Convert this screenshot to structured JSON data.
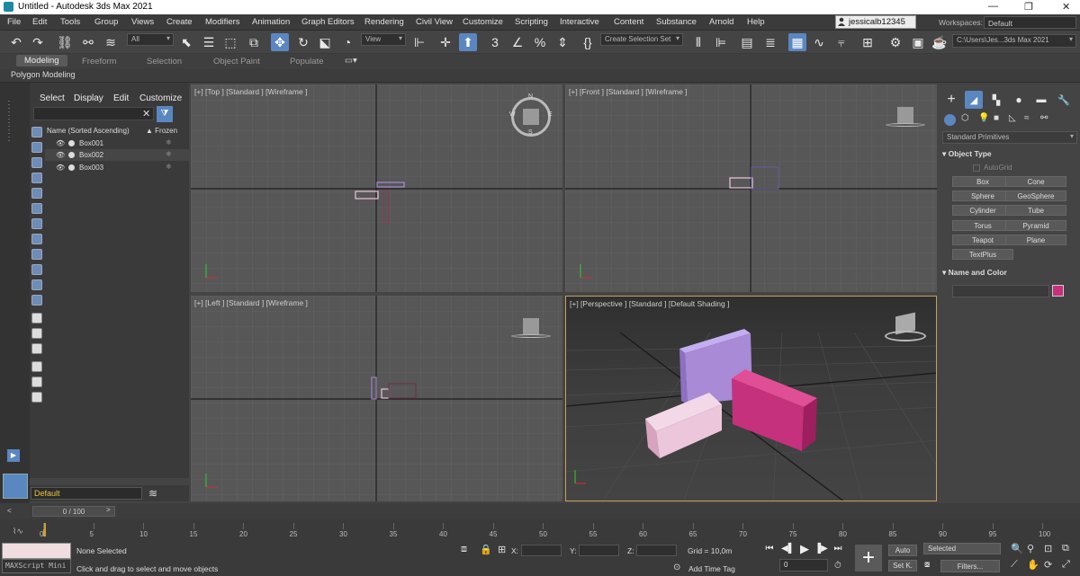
{
  "window": {
    "title": "Untitled - Autodesk 3ds Max 2021",
    "minimize": "—",
    "restore": "❐",
    "close": "✕"
  },
  "menu": [
    "File",
    "Edit",
    "Tools",
    "Group",
    "Views",
    "Create",
    "Modifiers",
    "Animation",
    "Graph Editors",
    "Rendering",
    "Civil View",
    "Customize",
    "Scripting",
    "Interactive",
    "Content",
    "Substance",
    "Arnold",
    "Help"
  ],
  "user": {
    "name": "jessicalb12345"
  },
  "workspaces": {
    "label": "Workspaces:",
    "value": "Default"
  },
  "toolbar": {
    "filter_dropdown": "All",
    "refcoord_dropdown": "View",
    "selection_set": "Create Selection Set",
    "project_path": "C:\\Users\\Jes...3ds Max 2021"
  },
  "ribbon": {
    "tabs": [
      "Modeling",
      "Freeform",
      "Selection",
      "Object Paint",
      "Populate"
    ],
    "subtitle": "Polygon Modeling"
  },
  "scene_explorer": {
    "menu": [
      "Select",
      "Display",
      "Edit",
      "Customize"
    ],
    "col_name": "Name (Sorted Ascending)",
    "col_frozen": "▲ Frozen",
    "objects": [
      "Box001",
      "Box002",
      "Box003"
    ]
  },
  "viewports": {
    "top": "[+] [Top ] [Standard ] [Wireframe ]",
    "front": "[+] [Front ] [Standard ] [Wireframe ]",
    "left": "[+] [Left ] [Standard ] [Wireframe ]",
    "perspective": "[+] [Perspective ] [Standard ] [Default Shading ]",
    "viewcube": {
      "n": "N",
      "s": "S",
      "e": "E",
      "w": "W"
    }
  },
  "command_panel": {
    "category": "Standard Primitives",
    "object_type": "Object Type",
    "autogrid": "AutoGrid",
    "primitives": [
      "Box",
      "Cone",
      "Sphere",
      "GeoSphere",
      "Cylinder",
      "Tube",
      "Torus",
      "Pyramid",
      "Teapot",
      "Plane",
      "TextPlus"
    ],
    "name_and_color": "Name and Color",
    "object_color": "#c5317d"
  },
  "layer": {
    "current": "Default"
  },
  "time": {
    "slider": "0 / 100",
    "ticks": [
      "0",
      "5",
      "10",
      "15",
      "20",
      "25",
      "30",
      "35",
      "40",
      "45",
      "50",
      "55",
      "60",
      "65",
      "70",
      "75",
      "80",
      "85",
      "90",
      "95",
      "100"
    ],
    "current_frame": "0"
  },
  "status": {
    "maxscript": "MAXScript Mini",
    "selection": "None Selected",
    "prompt": "Click and drag to select and move objects",
    "x_label": "X:",
    "y_label": "Y:",
    "z_label": "Z:",
    "grid": "Grid = 10,0m",
    "add_time_tag": "Add Time Tag",
    "auto": "Auto",
    "set_key": "Set K.",
    "selected": "Selected",
    "filters": "Filters..."
  },
  "colors": {
    "accent": "#5b87c1",
    "box001": "#a98ad6",
    "box002": "#c5317d",
    "box003": "#ecc6db"
  }
}
